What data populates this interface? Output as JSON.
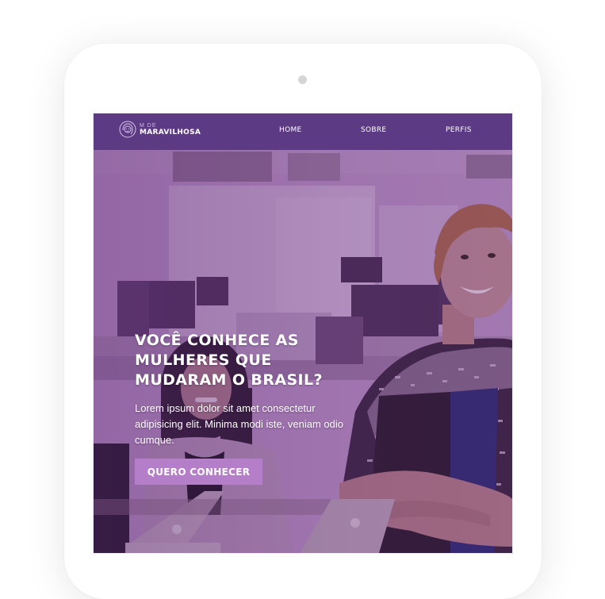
{
  "brand": {
    "small": "M DE",
    "name": "MARAVILHOSA"
  },
  "nav": {
    "items": [
      {
        "label": "HOME"
      },
      {
        "label": "SOBRE"
      },
      {
        "label": "PERFIS"
      }
    ]
  },
  "hero": {
    "headline_lines": [
      "VOCÊ CONHECE AS",
      "MULHERES QUE",
      "MUDARAM O BRASIL?"
    ],
    "lead": "Lorem ipsum dolor sit amet consectetur adipisicing elit. Minima modi iste, veniam odio cumque.",
    "cta_label": "QUERO CONHECER"
  },
  "colors": {
    "header_bg": "#5c3b84",
    "accent": "#b47fc8",
    "hero_tint": "#b78cc4"
  },
  "icons": {
    "logo": "woman-face-icon"
  }
}
